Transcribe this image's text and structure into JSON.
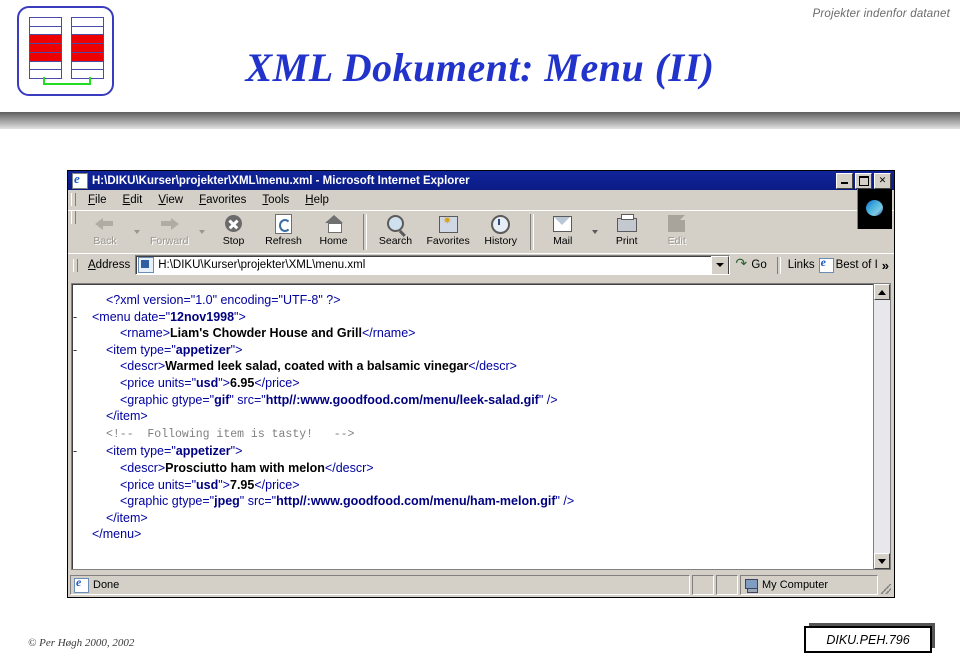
{
  "slide": {
    "kicker": "Projekter indenfor datanet",
    "title": "XML Dokument: Menu (II)",
    "footer_copyright": "© Per Høgh   2000, 2002",
    "footer_tag": "DIKU.PEH.796",
    "accent_color": "#2233cc"
  },
  "browser": {
    "window_title": "H:\\DIKU\\Kurser\\projekter\\XML\\menu.xml - Microsoft Internet Explorer",
    "window_buttons": [
      "Minimize",
      "Maximize",
      "Close"
    ],
    "menu": [
      {
        "label": "File",
        "accel": "F",
        "rest": "ile"
      },
      {
        "label": "Edit",
        "accel": "E",
        "rest": "dit"
      },
      {
        "label": "View",
        "accel": "V",
        "rest": "iew"
      },
      {
        "label": "Favorites",
        "accel": "F",
        "rest": "avorites"
      },
      {
        "label": "Tools",
        "accel": "T",
        "rest": "ools"
      },
      {
        "label": "Help",
        "accel": "H",
        "rest": "elp"
      }
    ],
    "toolbar": [
      {
        "label": "Back",
        "icon": "back-arrow-icon",
        "disabled": true
      },
      {
        "label": "Forward",
        "icon": "forward-arrow-icon",
        "disabled": true
      },
      {
        "label": "Stop",
        "icon": "stop-icon",
        "disabled": false
      },
      {
        "label": "Refresh",
        "icon": "refresh-icon",
        "disabled": false
      },
      {
        "label": "Home",
        "icon": "home-icon",
        "disabled": false
      },
      {
        "label": "Search",
        "icon": "search-icon",
        "disabled": false
      },
      {
        "label": "Favorites",
        "icon": "favorites-icon",
        "disabled": false
      },
      {
        "label": "History",
        "icon": "history-icon",
        "disabled": false
      },
      {
        "label": "Mail",
        "icon": "mail-icon",
        "disabled": false
      },
      {
        "label": "Print",
        "icon": "print-icon",
        "disabled": false
      },
      {
        "label": "Edit",
        "icon": "edit-icon",
        "disabled": true
      }
    ],
    "address": {
      "label": "Address",
      "accel": "A",
      "label_rest": "ddress",
      "value": "H:\\DIKU\\Kurser\\projekter\\XML\\menu.xml",
      "go_label": "Go",
      "links_label": "Links",
      "link_item": "Best of I",
      "overflow_chevron": "»"
    },
    "status": {
      "text": "Done",
      "zone": "My Computer"
    }
  },
  "xml": {
    "lines": [
      {
        "indent": 1,
        "twisty": "",
        "parts": [
          {
            "c": "tag",
            "t": "<?xml version=\"1.0\" encoding=\"UTF-8\" ?>"
          }
        ]
      },
      {
        "indent": 0,
        "twisty": "-",
        "parts": [
          {
            "c": "tag",
            "t": "<menu date=\""
          },
          {
            "c": "aval",
            "t": "12nov1998"
          },
          {
            "c": "tag",
            "t": "\">"
          }
        ]
      },
      {
        "indent": 2,
        "twisty": "",
        "parts": [
          {
            "c": "tag",
            "t": "<rname>"
          },
          {
            "c": "txt",
            "t": "Liam's Chowder House and Grill"
          },
          {
            "c": "tag",
            "t": "</rname>"
          }
        ]
      },
      {
        "indent": 1,
        "twisty": "-",
        "parts": [
          {
            "c": "tag",
            "t": "<item type=\""
          },
          {
            "c": "aval",
            "t": "appetizer"
          },
          {
            "c": "tag",
            "t": "\">"
          }
        ]
      },
      {
        "indent": 2,
        "twisty": "",
        "parts": [
          {
            "c": "tag",
            "t": "<descr>"
          },
          {
            "c": "txt",
            "t": "Warmed leek salad, coated with a balsamic vinegar"
          },
          {
            "c": "tag",
            "t": "</descr>"
          }
        ]
      },
      {
        "indent": 2,
        "twisty": "",
        "parts": [
          {
            "c": "tag",
            "t": "<price units=\""
          },
          {
            "c": "aval",
            "t": "usd"
          },
          {
            "c": "tag",
            "t": "\">"
          },
          {
            "c": "txt",
            "t": "6.95"
          },
          {
            "c": "tag",
            "t": "</price>"
          }
        ]
      },
      {
        "indent": 2,
        "twisty": "",
        "parts": [
          {
            "c": "tag",
            "t": "<graphic gtype=\""
          },
          {
            "c": "aval",
            "t": "gif"
          },
          {
            "c": "tag",
            "t": "\" src=\""
          },
          {
            "c": "aval",
            "t": "http//:www.goodfood.com/menu/leek-salad.gif"
          },
          {
            "c": "tag",
            "t": "\" />"
          }
        ]
      },
      {
        "indent": 1,
        "twisty": "",
        "parts": [
          {
            "c": "tag",
            "t": "</item>"
          }
        ]
      },
      {
        "indent": 1,
        "twisty": "",
        "parts": [
          {
            "c": "comment",
            "t": "<!--  Following item is tasty!   -->"
          }
        ]
      },
      {
        "indent": 1,
        "twisty": "-",
        "parts": [
          {
            "c": "tag",
            "t": "<item type=\""
          },
          {
            "c": "aval",
            "t": "appetizer"
          },
          {
            "c": "tag",
            "t": "\">"
          }
        ]
      },
      {
        "indent": 2,
        "twisty": "",
        "parts": [
          {
            "c": "tag",
            "t": "<descr>"
          },
          {
            "c": "txt",
            "t": "Prosciutto ham with melon"
          },
          {
            "c": "tag",
            "t": "</descr>"
          }
        ]
      },
      {
        "indent": 2,
        "twisty": "",
        "parts": [
          {
            "c": "tag",
            "t": "<price units=\""
          },
          {
            "c": "aval",
            "t": "usd"
          },
          {
            "c": "tag",
            "t": "\">"
          },
          {
            "c": "txt",
            "t": "7.95"
          },
          {
            "c": "tag",
            "t": "</price>"
          }
        ]
      },
      {
        "indent": 2,
        "twisty": "",
        "parts": [
          {
            "c": "tag",
            "t": "<graphic gtype=\""
          },
          {
            "c": "aval",
            "t": "jpeg"
          },
          {
            "c": "tag",
            "t": "\" src=\""
          },
          {
            "c": "aval",
            "t": "http//:www.goodfood.com/menu/ham-melon.gif"
          },
          {
            "c": "tag",
            "t": "\" />"
          }
        ]
      },
      {
        "indent": 1,
        "twisty": "",
        "parts": [
          {
            "c": "tag",
            "t": "</item>"
          }
        ]
      },
      {
        "indent": 0,
        "twisty": "",
        "parts": [
          {
            "c": "tag",
            "t": "</menu>"
          }
        ]
      }
    ]
  },
  "logo": {
    "columns": [
      {
        "cells": [
          "white",
          "white",
          "red",
          "red",
          "red",
          "white",
          "white"
        ]
      },
      {
        "cells": [
          "white",
          "white",
          "red",
          "red",
          "red",
          "white",
          "white"
        ]
      }
    ],
    "frame_color": "#3b3bbf",
    "cell_red": "#ee0000",
    "link_color": "#22dd22"
  }
}
